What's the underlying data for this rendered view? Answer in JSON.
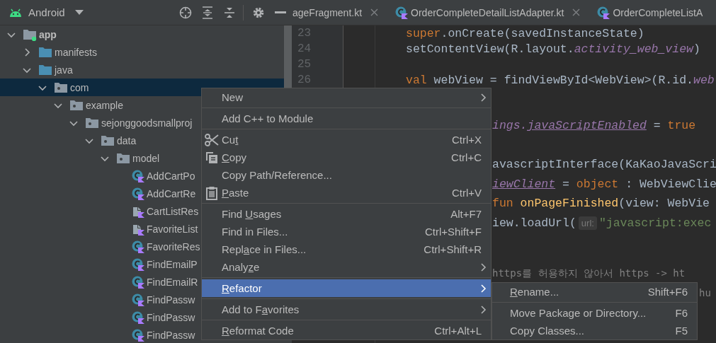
{
  "project_view": {
    "title": "Android",
    "tree": [
      {
        "label": "app",
        "kind": "module",
        "expanded": true,
        "selected": false,
        "children": [
          {
            "label": "manifests",
            "kind": "folder",
            "expanded": false,
            "selected": false
          },
          {
            "label": "java",
            "kind": "folder",
            "expanded": true,
            "selected": false,
            "children": [
              {
                "label": "com",
                "kind": "package",
                "expanded": true,
                "selected": true,
                "children": [
                  {
                    "label": "example",
                    "kind": "package",
                    "expanded": true,
                    "selected": false,
                    "children": [
                      {
                        "label": "sejonggoodsmallproj",
                        "kind": "package",
                        "expanded": true,
                        "selected": false,
                        "children": [
                          {
                            "label": "data",
                            "kind": "package",
                            "expanded": true,
                            "selected": false,
                            "children": [
                              {
                                "label": "model",
                                "kind": "package",
                                "expanded": true,
                                "selected": false,
                                "children": [
                                  {
                                    "label": "AddCartPo",
                                    "kind": "class",
                                    "selected": false
                                  },
                                  {
                                    "label": "AddCartRe",
                                    "kind": "class",
                                    "selected": false
                                  },
                                  {
                                    "label": "CartListRes",
                                    "kind": "file",
                                    "selected": false
                                  },
                                  {
                                    "label": "FavoriteList",
                                    "kind": "file",
                                    "selected": false
                                  },
                                  {
                                    "label": "FavoriteRes",
                                    "kind": "class",
                                    "selected": false
                                  },
                                  {
                                    "label": "FindEmailP",
                                    "kind": "class",
                                    "selected": false
                                  },
                                  {
                                    "label": "FindEmailR",
                                    "kind": "class",
                                    "selected": false
                                  },
                                  {
                                    "label": "FindPassw",
                                    "kind": "class",
                                    "selected": false
                                  },
                                  {
                                    "label": "FindPassw",
                                    "kind": "class",
                                    "selected": false
                                  },
                                  {
                                    "label": "FindPassw",
                                    "kind": "class",
                                    "selected": false
                                  }
                                ]
                              }
                            ]
                          }
                        ]
                      }
                    ]
                  }
                ]
              }
            ]
          }
        ]
      }
    ]
  },
  "editor_tabs": [
    {
      "label": "ageFragment.kt",
      "kind": "plain",
      "selected": false
    },
    {
      "label": "OrderCompleteDetailListAdapter.kt",
      "kind": "class",
      "selected": false
    },
    {
      "label": "OrderCompleteListA",
      "kind": "class",
      "selected": false
    }
  ],
  "code_lines": [
    {
      "kind": "full",
      "number": "23",
      "tokens": [
        {
          "kind": "keyword",
          "text": "super"
        },
        {
          "kind": "plain",
          "text": ".onCreate(savedInstanceState)"
        }
      ]
    },
    {
      "kind": "full",
      "number": "24",
      "tokens": [
        {
          "kind": "plain",
          "text": "setContentView(R.layout."
        },
        {
          "kind": "field",
          "text": "activity_web_view"
        },
        {
          "kind": "plain",
          "text": ")"
        }
      ]
    },
    {
      "kind": "blank",
      "number": "25"
    },
    {
      "kind": "full",
      "number": "26",
      "tokens": [
        {
          "kind": "keyword",
          "text": "val "
        },
        {
          "kind": "plain",
          "text": "webView = findViewById<WebView>(R.id."
        },
        {
          "kind": "field",
          "text": "web"
        }
      ]
    },
    {
      "kind": "blank"
    },
    {
      "kind": "right",
      "tokens": [
        {
          "kind": "field",
          "text": "ings."
        },
        {
          "kind": "synthetic",
          "text": "javaScriptEnabled"
        },
        {
          "kind": "plain",
          "text": " = "
        },
        {
          "kind": "keyword",
          "text": "true"
        }
      ]
    },
    {
      "kind": "blank"
    },
    {
      "kind": "right",
      "tokens": [
        {
          "kind": "plain",
          "text": "avascriptInterface(KaKaoJavaScri"
        }
      ]
    },
    {
      "kind": "right",
      "tokens": [
        {
          "kind": "synthetic",
          "text": "iewClient"
        },
        {
          "kind": "plain",
          "text": " = "
        },
        {
          "kind": "keyword",
          "text": "object"
        },
        {
          "kind": "plain",
          "text": " : WebViewClie"
        }
      ]
    },
    {
      "kind": "right",
      "tokens": [
        {
          "kind": "keyword",
          "text": " fun "
        },
        {
          "kind": "function",
          "text": "onPageFinished"
        },
        {
          "kind": "plain",
          "text": "(view: WebVie"
        }
      ]
    },
    {
      "kind": "right",
      "tokens": [
        {
          "kind": "plain",
          "text": "iew.loadUrl("
        },
        {
          "kind": "hint",
          "text": "url:"
        },
        {
          "kind": "string",
          "text": "\"javascript:exec"
        }
      ]
    },
    {
      "kind": "blank"
    },
    {
      "kind": "blank"
    },
    {
      "kind": "right",
      "tokens": [
        {
          "kind": "comment",
          "text": "https를 허용하지 않아서 https -> ht"
        }
      ]
    },
    {
      "kind": "tail",
      "tokens": [
        {
          "kind": "comment",
          "text": "hu"
        }
      ]
    }
  ],
  "context_menu": [
    {
      "kind": "item",
      "label": "New",
      "submenu": true,
      "selected": false
    },
    {
      "kind": "separator"
    },
    {
      "kind": "item",
      "label": "Add C++ to Module",
      "selected": false
    },
    {
      "kind": "separator"
    },
    {
      "kind": "cut",
      "label": [
        {
          "text": "Cu",
          "mnemonic": false
        },
        {
          "text": "t",
          "mnemonic": true
        }
      ],
      "shortcut": "Ctrl+X",
      "selected": false
    },
    {
      "kind": "copy",
      "label": [
        {
          "text": "C",
          "mnemonic": true
        },
        {
          "text": "opy",
          "mnemonic": false
        }
      ],
      "shortcut": "Ctrl+C",
      "selected": false
    },
    {
      "kind": "item",
      "label": "Copy Path/Reference...",
      "selected": false
    },
    {
      "kind": "paste",
      "label": [
        {
          "text": "P",
          "mnemonic": true
        },
        {
          "text": "aste",
          "mnemonic": false
        }
      ],
      "shortcut": "Ctrl+V",
      "selected": false
    },
    {
      "kind": "separator"
    },
    {
      "kind": "item",
      "label": [
        {
          "text": "Find ",
          "mnemonic": false
        },
        {
          "text": "U",
          "mnemonic": true
        },
        {
          "text": "sages",
          "mnemonic": false
        }
      ],
      "shortcut": "Alt+F7",
      "selected": false
    },
    {
      "kind": "item",
      "label": "Find in Files...",
      "shortcut": "Ctrl+Shift+F",
      "selected": false
    },
    {
      "kind": "item",
      "label": [
        {
          "text": "Repl",
          "mnemonic": false
        },
        {
          "text": "a",
          "mnemonic": true
        },
        {
          "text": "ce in Files...",
          "mnemonic": false
        }
      ],
      "shortcut": "Ctrl+Shift+R",
      "selected": false
    },
    {
      "kind": "item",
      "label": [
        {
          "text": "Analy",
          "mnemonic": false
        },
        {
          "text": "z",
          "mnemonic": true
        },
        {
          "text": "e",
          "mnemonic": false
        }
      ],
      "submenu": true,
      "selected": false
    },
    {
      "kind": "separator"
    },
    {
      "kind": "item",
      "label": [
        {
          "text": "R",
          "mnemonic": true
        },
        {
          "text": "efactor",
          "mnemonic": false
        }
      ],
      "submenu": true,
      "selected": true
    },
    {
      "kind": "separator"
    },
    {
      "kind": "item",
      "label": [
        {
          "text": "Add to F",
          "mnemonic": false
        },
        {
          "text": "a",
          "mnemonic": true
        },
        {
          "text": "vorites",
          "mnemonic": false
        }
      ],
      "submenu": true,
      "selected": false
    },
    {
      "kind": "separator"
    },
    {
      "kind": "item",
      "label": [
        {
          "text": "R",
          "mnemonic": true
        },
        {
          "text": "eformat Code",
          "mnemonic": false
        }
      ],
      "shortcut": "Ctrl+Alt+L",
      "selected": false
    }
  ],
  "refactor_submenu": [
    {
      "kind": "item",
      "label": [
        {
          "text": "R",
          "mnemonic": true
        },
        {
          "text": "ename...",
          "mnemonic": false
        }
      ],
      "shortcut": "Shift+F6",
      "selected": false
    },
    {
      "kind": "separator"
    },
    {
      "kind": "item",
      "label": "Move Package or Directory...",
      "shortcut": "F6",
      "selected": false
    },
    {
      "kind": "item",
      "label": "Copy Classes...",
      "shortcut": "F5",
      "selected": false
    }
  ]
}
